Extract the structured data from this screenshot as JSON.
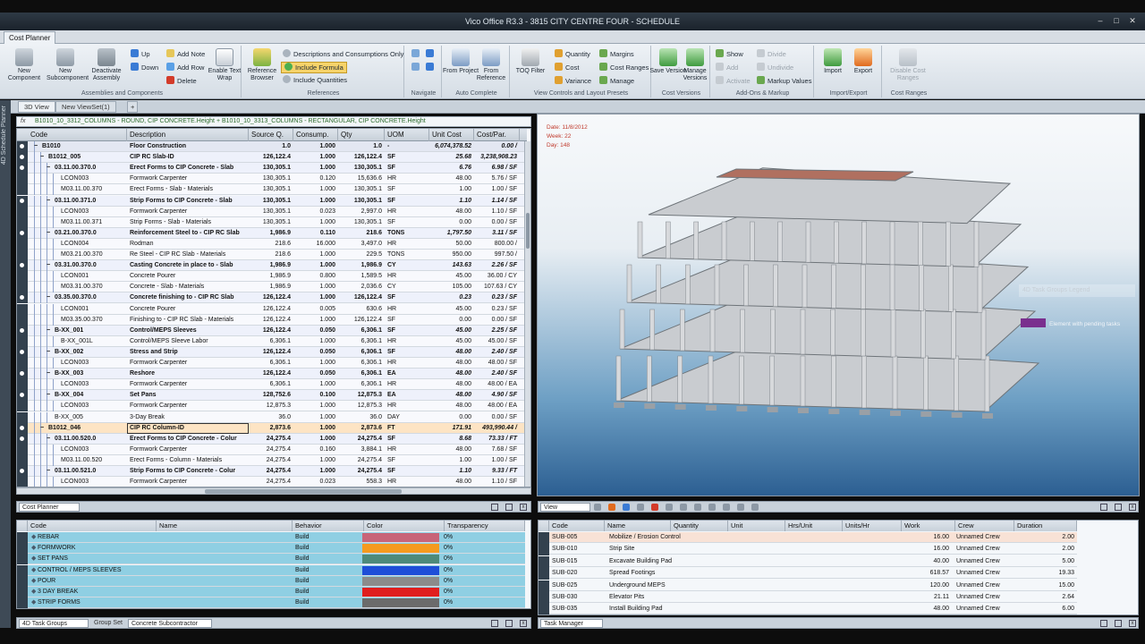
{
  "window": {
    "title": "Vico Office R3.3 - 3815 CITY CENTRE FOUR - SCHEDULE"
  },
  "ribbon": {
    "tab": "Cost Planner",
    "groups": [
      {
        "label": "Assemblies and Components",
        "buttons": [
          "New Component",
          "New Subcomponent",
          "Deactivate Assembly"
        ],
        "small": [
          "Up",
          "Down",
          "Add Note",
          "Add Row",
          "Delete"
        ],
        "big2": "Enable Text Wrap"
      },
      {
        "label": "References",
        "buttons": [
          "Reference Browser"
        ],
        "small": [
          "Descriptions and Consumptions Only",
          "Include Formula",
          "Include Quantities"
        ]
      },
      {
        "label": "Navigate"
      },
      {
        "label": "Auto Complete",
        "buttons": [
          "From Project",
          "From Reference"
        ]
      },
      {
        "label": "View Controls and Layout Presets",
        "buttons": [
          "TOQ Filter"
        ],
        "small": [
          "Quantity",
          "Cost",
          "Variance",
          "Margins",
          "Cost Ranges",
          "Manage"
        ]
      },
      {
        "label": "Cost Versions",
        "buttons": [
          "Save Version",
          "Manage Versions"
        ]
      },
      {
        "label": "Add-Ons & Markup",
        "small": [
          "Show",
          "Add",
          "Activate",
          "Divide",
          "Undivide",
          "Markup Values"
        ]
      },
      {
        "label": "Import/Export",
        "buttons": [
          "Import",
          "Export"
        ]
      },
      {
        "label": "Cost Ranges",
        "buttons": [
          "Disable Cost Ranges"
        ]
      }
    ]
  },
  "sidebar": {
    "label": "4D Schedule Planner"
  },
  "view_tabs": [
    "3D View",
    "New ViewSet(1)"
  ],
  "formula": {
    "fx": "fx",
    "text": "B1010_10_3312_COLUMNS - ROUND, CIP CONCRETE.Height + B1010_10_3313_COLUMNS - RECTANGULAR, CIP CONCRETE.Height"
  },
  "cost_grid": {
    "columns": [
      "Code",
      "Description",
      "Source Q.",
      "Consump.",
      "Qty",
      "UOM",
      "Unit Cost",
      "Cost/Par."
    ],
    "rows": [
      {
        "code": "B1010",
        "desc": "Floor Construction",
        "src": "1.0",
        "cons": "1.000",
        "qty": "1.0",
        "uom": "-",
        "unit": "6,074,378.52",
        "cost": "0.00 /",
        "bold": true,
        "lvl": 2
      },
      {
        "code": "B1012_005",
        "desc": "CIP RC Slab-ID",
        "src": "126,122.4",
        "cons": "1.000",
        "qty": "126,122.4",
        "uom": "SF",
        "unit": "25.68",
        "cost": "3,238,908.23",
        "bold": true,
        "lvl": 3
      },
      {
        "code": "03.11.00.370.0",
        "desc": "Erect Forms to CIP Concrete - Slab",
        "src": "130,305.1",
        "cons": "1.000",
        "qty": "130,305.1",
        "uom": "SF",
        "unit": "6.76",
        "cost": "6.98 / SF",
        "bold": true,
        "lvl": 4
      },
      {
        "code": "LCON003",
        "desc": "Formwork Carpenter",
        "src": "130,305.1",
        "cons": "0.120",
        "qty": "15,636.6",
        "uom": "HR",
        "unit": "48.00",
        "cost": "5.76 / SF",
        "bold": false,
        "lvl": 5
      },
      {
        "code": "M03.11.00.370",
        "desc": "Erect Forms - Slab - Materials",
        "src": "130,305.1",
        "cons": "1.000",
        "qty": "130,305.1",
        "uom": "SF",
        "unit": "1.00",
        "cost": "1.00 / SF",
        "bold": false,
        "lvl": 5
      },
      {
        "code": "03.11.00.371.0",
        "desc": "Strip Forms to CIP Concrete - Slab",
        "src": "130,305.1",
        "cons": "1.000",
        "qty": "130,305.1",
        "uom": "SF",
        "unit": "1.10",
        "cost": "1.14 / SF",
        "bold": true,
        "lvl": 4
      },
      {
        "code": "LCON003",
        "desc": "Formwork Carpenter",
        "src": "130,305.1",
        "cons": "0.023",
        "qty": "2,997.0",
        "uom": "HR",
        "unit": "48.00",
        "cost": "1.10 / SF",
        "bold": false,
        "lvl": 5
      },
      {
        "code": "M03.11.00.371",
        "desc": "Strip Forms - Slab - Materials",
        "src": "130,305.1",
        "cons": "1.000",
        "qty": "130,305.1",
        "uom": "SF",
        "unit": "0.00",
        "cost": "0.00 / SF",
        "bold": false,
        "lvl": 5
      },
      {
        "code": "03.21.00.370.0",
        "desc": "Reinforcement Steel to - CIP RC Slab",
        "src": "1,986.9",
        "cons": "0.110",
        "qty": "218.6",
        "uom": "TONS",
        "unit": "1,797.50",
        "cost": "3.11 / SF",
        "bold": true,
        "lvl": 4
      },
      {
        "code": "LCON004",
        "desc": "Rodman",
        "src": "218.6",
        "cons": "16.000",
        "qty": "3,497.0",
        "uom": "HR",
        "unit": "50.00",
        "cost": "800.00 /",
        "bold": false,
        "lvl": 5
      },
      {
        "code": "M03.21.00.370",
        "desc": "Re Steel - CIP RC Slab - Materials",
        "src": "218.6",
        "cons": "1.000",
        "qty": "229.5",
        "uom": "TONS",
        "unit": "950.00",
        "cost": "997.50 /",
        "bold": false,
        "lvl": 5
      },
      {
        "code": "03.31.00.370.0",
        "desc": "Casting Concrete in place to - Slab",
        "src": "1,986.9",
        "cons": "1.000",
        "qty": "1,986.9",
        "uom": "CY",
        "unit": "143.63",
        "cost": "2.26 / SF",
        "bold": true,
        "lvl": 4
      },
      {
        "code": "LCON001",
        "desc": "Concrete Pourer",
        "src": "1,986.9",
        "cons": "0.800",
        "qty": "1,589.5",
        "uom": "HR",
        "unit": "45.00",
        "cost": "36.00 / CY",
        "bold": false,
        "lvl": 5
      },
      {
        "code": "M03.31.00.370",
        "desc": "Concrete - Slab - Materials",
        "src": "1,986.9",
        "cons": "1.000",
        "qty": "2,036.6",
        "uom": "CY",
        "unit": "105.00",
        "cost": "107.63 / CY",
        "bold": false,
        "lvl": 5
      },
      {
        "code": "03.35.00.370.0",
        "desc": "Concrete finishing to - CIP RC Slab",
        "src": "126,122.4",
        "cons": "1.000",
        "qty": "126,122.4",
        "uom": "SF",
        "unit": "0.23",
        "cost": "0.23 / SF",
        "bold": true,
        "lvl": 4
      },
      {
        "code": "LCON001",
        "desc": "Concrete Pourer",
        "src": "126,122.4",
        "cons": "0.005",
        "qty": "630.6",
        "uom": "HR",
        "unit": "45.00",
        "cost": "0.23 / SF",
        "bold": false,
        "lvl": 5
      },
      {
        "code": "M03.35.00.370",
        "desc": "Finishing to - CIP RC Slab - Materials",
        "src": "126,122.4",
        "cons": "1.000",
        "qty": "126,122.4",
        "uom": "SF",
        "unit": "0.00",
        "cost": "0.00 / SF",
        "bold": false,
        "lvl": 5
      },
      {
        "code": "B-XX_001",
        "desc": "Control/MEPS Sleeves",
        "src": "126,122.4",
        "cons": "0.050",
        "qty": "6,306.1",
        "uom": "SF",
        "unit": "45.00",
        "cost": "2.25 / SF",
        "bold": true,
        "lvl": 4
      },
      {
        "code": "B-XX_001L",
        "desc": "Control/MEPS Sleeve Labor",
        "src": "6,306.1",
        "cons": "1.000",
        "qty": "6,306.1",
        "uom": "HR",
        "unit": "45.00",
        "cost": "45.00 / SF",
        "bold": false,
        "lvl": 5
      },
      {
        "code": "B-XX_002",
        "desc": "Stress and Strip",
        "src": "126,122.4",
        "cons": "0.050",
        "qty": "6,306.1",
        "uom": "SF",
        "unit": "48.00",
        "cost": "2.40 / SF",
        "bold": true,
        "lvl": 4
      },
      {
        "code": "LCON003",
        "desc": "Formwork Carpenter",
        "src": "6,306.1",
        "cons": "1.000",
        "qty": "6,306.1",
        "uom": "HR",
        "unit": "48.00",
        "cost": "48.00 / SF",
        "bold": false,
        "lvl": 5
      },
      {
        "code": "B-XX_003",
        "desc": "Reshore",
        "src": "126,122.4",
        "cons": "0.050",
        "qty": "6,306.1",
        "uom": "EA",
        "unit": "48.00",
        "cost": "2.40 / SF",
        "bold": true,
        "lvl": 4
      },
      {
        "code": "LCON003",
        "desc": "Formwork Carpenter",
        "src": "6,306.1",
        "cons": "1.000",
        "qty": "6,306.1",
        "uom": "HR",
        "unit": "48.00",
        "cost": "48.00 / EA",
        "bold": false,
        "lvl": 5
      },
      {
        "code": "B-XX_004",
        "desc": "Set Pans",
        "src": "128,752.6",
        "cons": "0.100",
        "qty": "12,875.3",
        "uom": "EA",
        "unit": "48.00",
        "cost": "4.90 / SF",
        "bold": true,
        "lvl": 4
      },
      {
        "code": "LCON003",
        "desc": "Formwork Carpenter",
        "src": "12,875.3",
        "cons": "1.000",
        "qty": "12,875.3",
        "uom": "HR",
        "unit": "48.00",
        "cost": "48.00 / EA",
        "bold": false,
        "lvl": 5
      },
      {
        "code": "B-XX_005",
        "desc": "3-Day Break",
        "src": "36.0",
        "cons": "1.000",
        "qty": "36.0",
        "uom": "DAY",
        "unit": "0.00",
        "cost": "0.00 / SF",
        "bold": false,
        "lvl": 4
      },
      {
        "code": "B1012_046",
        "desc": "CIP RC Column-ID",
        "src": "2,873.6",
        "cons": "1.000",
        "qty": "2,873.6",
        "uom": "FT",
        "unit": "171.91",
        "cost": "493,990.44 /",
        "bold": true,
        "lvl": 3,
        "sel": true
      },
      {
        "code": "03.11.00.520.0",
        "desc": "Erect Forms to CIP Concrete - Colur",
        "src": "24,275.4",
        "cons": "1.000",
        "qty": "24,275.4",
        "uom": "SF",
        "unit": "8.68",
        "cost": "73.33 / FT",
        "bold": true,
        "lvl": 4
      },
      {
        "code": "LCON003",
        "desc": "Formwork Carpenter",
        "src": "24,275.4",
        "cons": "0.160",
        "qty": "3,884.1",
        "uom": "HR",
        "unit": "48.00",
        "cost": "7.68 / SF",
        "bold": false,
        "lvl": 5
      },
      {
        "code": "M03.11.00.520",
        "desc": "Erect Forms - Column - Materials",
        "src": "24,275.4",
        "cons": "1.000",
        "qty": "24,275.4",
        "uom": "SF",
        "unit": "1.00",
        "cost": "1.00 / SF",
        "bold": false,
        "lvl": 5
      },
      {
        "code": "03.11.00.521.0",
        "desc": "Strip Forms to CIP Concrete - Colur",
        "src": "24,275.4",
        "cons": "1.000",
        "qty": "24,275.4",
        "uom": "SF",
        "unit": "1.10",
        "cost": "9.33 / FT",
        "bold": true,
        "lvl": 4
      },
      {
        "code": "LCON003",
        "desc": "Formwork Carpenter",
        "src": "24,275.4",
        "cons": "0.023",
        "qty": "558.3",
        "uom": "HR",
        "unit": "48.00",
        "cost": "1.10 / SF",
        "bold": false,
        "lvl": 5
      }
    ]
  },
  "viewport": {
    "date": "Date: 11/8/2012",
    "week": "Week: 22",
    "day": "Day: 148",
    "legend_title": "4D Task Groups Legend",
    "legend_item": "Element with pending tasks",
    "legend_color": "#7a2f8e"
  },
  "panel_left": {
    "combo": "Cost Planner"
  },
  "panel_right": {
    "combo": "View"
  },
  "task_groups": {
    "columns": [
      "Code",
      "Name",
      "Behavior",
      "Color",
      "Transparency"
    ],
    "rows": [
      {
        "code": "REBAR",
        "behavior": "Build",
        "color": "#c86478",
        "transp": "0%"
      },
      {
        "code": "FORMWORK",
        "behavior": "Build",
        "color": "#f59a1e",
        "transp": "0%"
      },
      {
        "code": "SET PANS",
        "behavior": "Build",
        "color": "#4d8a7a",
        "transp": "0%"
      },
      {
        "code": "CONTROL / MEPS SLEEVES",
        "behavior": "Build",
        "color": "#1e4ed8",
        "transp": "0%"
      },
      {
        "code": "POUR",
        "behavior": "Build",
        "color": "#8b8b8b",
        "transp": "0%"
      },
      {
        "code": "3 DAY BREAK",
        "behavior": "Build",
        "color": "#e01e1e",
        "transp": "0%"
      },
      {
        "code": "STRIP FORMS",
        "behavior": "Build",
        "color": "#6b6b6b",
        "transp": "0%"
      }
    ]
  },
  "task_manager": {
    "columns": [
      "Code",
      "Name",
      "Quantity",
      "Unit",
      "Hrs/Unit",
      "Units/Hr",
      "Work",
      "Crew",
      "Duration"
    ],
    "rows": [
      {
        "code": "SUB-005",
        "name": "Mobilize / Erosion Control",
        "work": "16.00",
        "crew": "Unnamed Crew",
        "dur": "2.00"
      },
      {
        "code": "SUB-010",
        "name": "Strip Site",
        "work": "16.00",
        "crew": "Unnamed Crew",
        "dur": "2.00"
      },
      {
        "code": "SUB-015",
        "name": "Excavate Building Pad",
        "work": "40.00",
        "crew": "Unnamed Crew",
        "dur": "5.00"
      },
      {
        "code": "SUB-020",
        "name": "Spread Footings",
        "work": "618.57",
        "crew": "Unnamed Crew",
        "dur": "19.33"
      },
      {
        "code": "SUB-025",
        "name": "Underground MEPS",
        "work": "120.00",
        "crew": "Unnamed Crew",
        "dur": "15.00"
      },
      {
        "code": "SUB-030",
        "name": "Elevator Pits",
        "work": "21.11",
        "crew": "Unnamed Crew",
        "dur": "2.64"
      },
      {
        "code": "SUB-035",
        "name": "Install Building Pad",
        "work": "48.00",
        "crew": "Unnamed Crew",
        "dur": "6.00"
      }
    ]
  },
  "bottom_left": {
    "combo": "4D Task Groups",
    "group_set_label": "Group Set",
    "group_set_value": "Concrete Subcontractor"
  },
  "bottom_right": {
    "combo": "Task Manager"
  }
}
